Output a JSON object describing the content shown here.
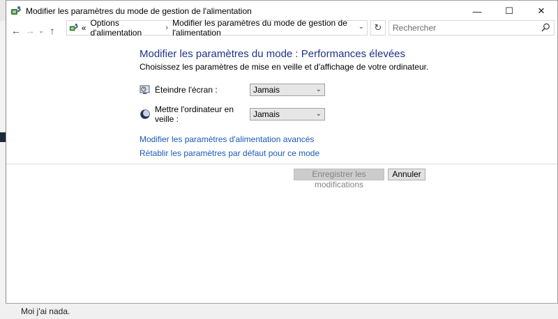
{
  "window": {
    "title": "Modifier les paramètres du mode de gestion de l'alimentation",
    "minimize": "—",
    "maximize": "☐",
    "close": "✕"
  },
  "nav": {
    "back": "←",
    "forward": "→",
    "recent": "⌄",
    "up": "↑"
  },
  "address": {
    "prefix": "«",
    "crumbs": [
      "Options d'alimentation",
      "Modifier les paramètres du mode de gestion de l'alimentation"
    ],
    "separator": "›",
    "dropdown": "⌄",
    "refresh": "↻"
  },
  "search": {
    "placeholder": "Rechercher"
  },
  "content": {
    "heading": "Modifier les paramètres du mode : Performances élevées",
    "subtitle": "Choisissez les paramètres de mise en veille et d'affichage de votre ordinateur.",
    "settings": [
      {
        "label": "Éteindre l'écran :",
        "value": "Jamais",
        "icon": "monitor-icon"
      },
      {
        "label": "Mettre l'ordinateur en veille :",
        "value": "Jamais",
        "icon": "moon-icon"
      }
    ],
    "links": [
      "Modifier les paramètres d'alimentation avancés",
      "Rétablir les paramètres par défaut pour ce mode"
    ]
  },
  "buttons": {
    "save": "Enregistrer les modifications",
    "cancel": "Annuler"
  },
  "background": {
    "text": "Moi j'ai nada."
  }
}
